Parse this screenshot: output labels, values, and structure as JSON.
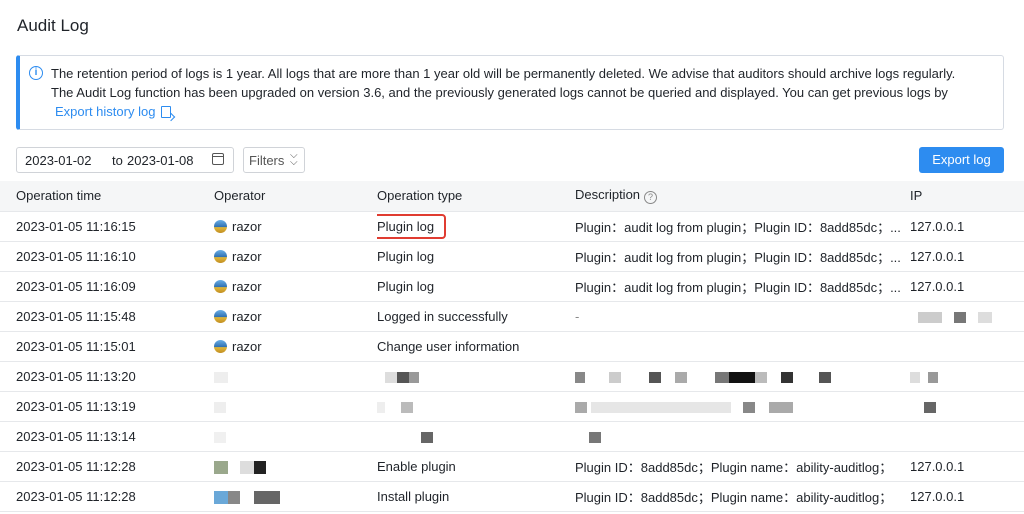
{
  "page": {
    "title": "Audit Log"
  },
  "alert": {
    "line1": "The retention period of logs is 1 year. All logs that are more than 1 year old will be permanently deleted. We advise that auditors should archive logs regularly.",
    "line2": "The Audit Log function has been upgraded on version 3.6, and the previously generated logs cannot be queried and displayed. You can get previous logs by",
    "link": "Export history log"
  },
  "toolbar": {
    "date_from": "2023-01-02",
    "date_sep": "to",
    "date_to": "2023-01-08",
    "filters_label": "Filters",
    "export_label": "Export log"
  },
  "table": {
    "headers": {
      "time": "Operation time",
      "operator": "Operator",
      "type": "Operation type",
      "desc": "Description",
      "ip": "IP"
    },
    "rows": [
      {
        "time": "2023-01-05 11:16:15",
        "operator": "razor",
        "type": "Plugin log",
        "desc": "Plugin：audit log from plugin；Plugin ID：8add85dc；...",
        "ip": "127.0.0.1"
      },
      {
        "time": "2023-01-05 11:16:10",
        "operator": "razor",
        "type": "Plugin log",
        "desc": "Plugin：audit log from plugin；Plugin ID：8add85dc；...",
        "ip": "127.0.0.1"
      },
      {
        "time": "2023-01-05 11:16:09",
        "operator": "razor",
        "type": "Plugin log",
        "desc": "Plugin：audit log from plugin；Plugin ID：8add85dc；...",
        "ip": "127.0.0.1"
      },
      {
        "time": "2023-01-05 11:15:48",
        "operator": "razor",
        "type": "Logged in successfully",
        "desc": "-",
        "ip": ""
      },
      {
        "time": "2023-01-05 11:15:01",
        "operator": "razor",
        "type": "Change user information",
        "desc": "",
        "ip": ""
      },
      {
        "time": "2023-01-05 11:13:20",
        "operator": "",
        "type": "",
        "desc": "",
        "ip": ""
      },
      {
        "time": "2023-01-05 11:13:19",
        "operator": "",
        "type": "",
        "desc": "",
        "ip": ""
      },
      {
        "time": "2023-01-05 11:13:14",
        "operator": "",
        "type": "",
        "desc": "",
        "ip": ""
      },
      {
        "time": "2023-01-05 11:12:28",
        "operator": "",
        "type": "Enable plugin",
        "desc": "Plugin ID：8add85dc；Plugin name：ability-auditlog；",
        "ip": "127.0.0.1"
      },
      {
        "time": "2023-01-05 11:12:28",
        "operator": "",
        "type": "Install plugin",
        "desc": "Plugin ID：8add85dc；Plugin name：ability-auditlog；",
        "ip": "127.0.0.1"
      }
    ]
  },
  "icons": {
    "info": "info-circle-icon",
    "export_link": "export-file-icon",
    "calendar": "calendar-icon",
    "filters": "double-chevron-down-icon",
    "help": "question-circle-icon",
    "avatar": "user-avatar"
  },
  "colors": {
    "accent": "#2d8cf0",
    "highlight": "#e03c31"
  }
}
